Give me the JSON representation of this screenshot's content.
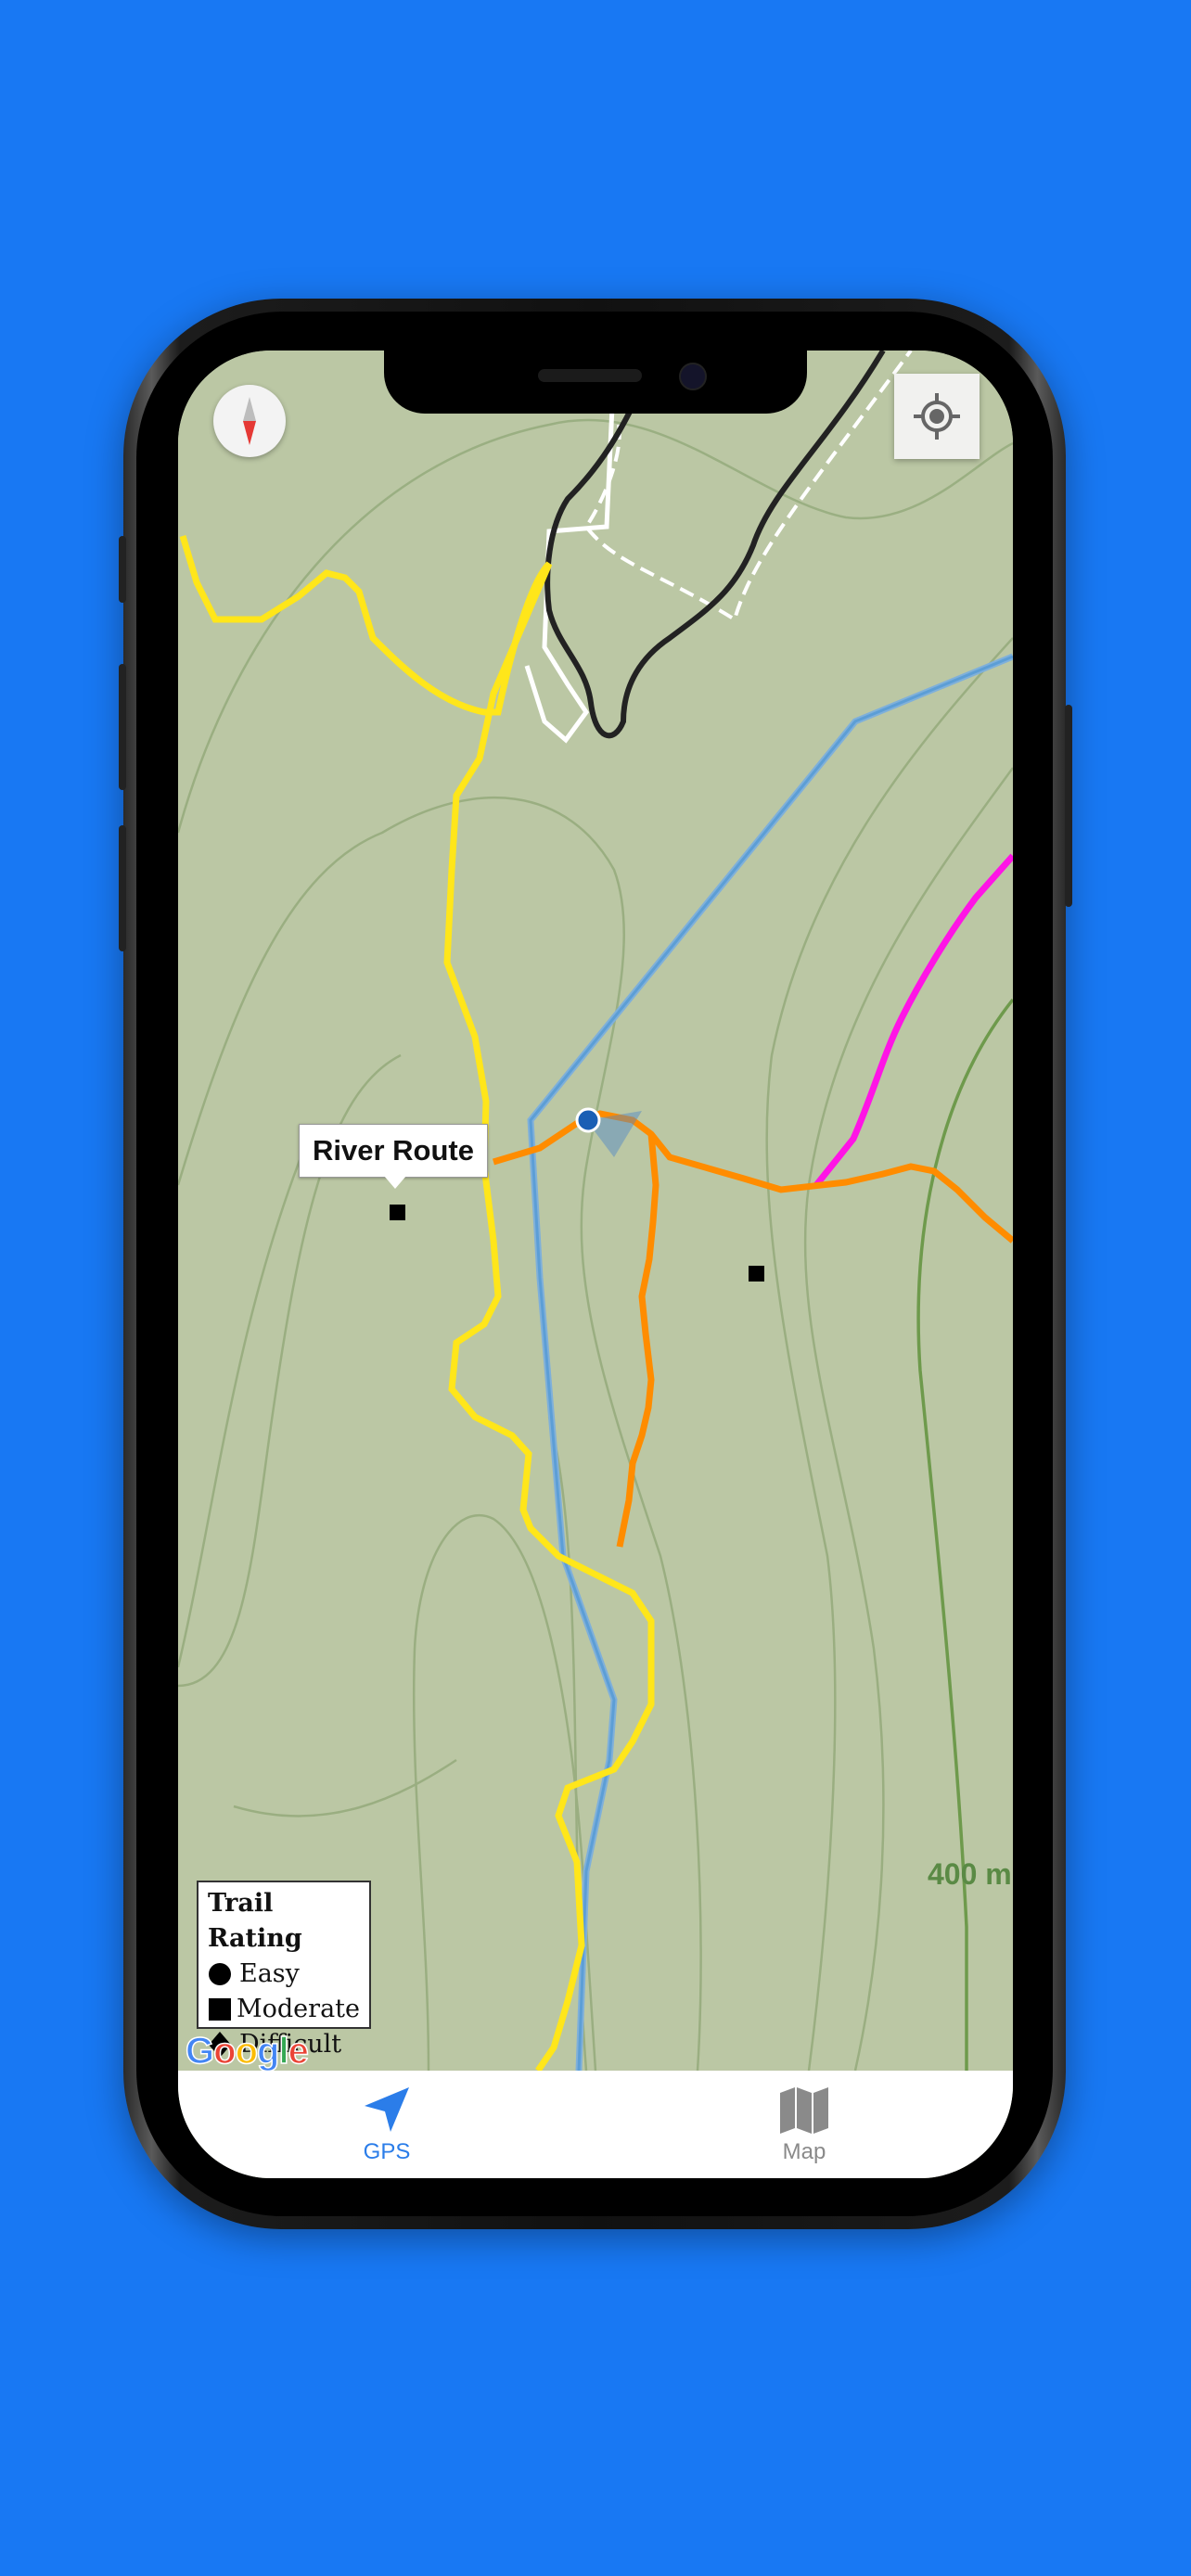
{
  "map": {
    "callout_label": "River Route",
    "scale_label": "400 m",
    "attribution": [
      "G",
      "o",
      "o",
      "g",
      "l",
      "e"
    ],
    "trail_colors": {
      "easy": "#ffe61a",
      "moderate": "#ff8c00",
      "difficult": "#ff14e6",
      "black": "#222222",
      "river": "#6aa9e0"
    }
  },
  "legend": {
    "title": "Trail Rating",
    "items": [
      {
        "symbol": "circle",
        "label": "Easy"
      },
      {
        "symbol": "square",
        "label": "Moderate"
      },
      {
        "symbol": "diamond",
        "label": "Difficult"
      }
    ]
  },
  "controls": {
    "compass": "compass-icon",
    "locate": "crosshair-icon"
  },
  "tabs": [
    {
      "label": "GPS",
      "icon": "navigation-arrow-icon",
      "active": true,
      "color": "#2b7de9"
    },
    {
      "label": "Map",
      "icon": "folded-map-icon",
      "active": false,
      "color": "#8a8a8a"
    }
  ],
  "colors": {
    "background": "#1878f3",
    "map_land": "#bbc7a4",
    "contour": "#97ac7e"
  }
}
